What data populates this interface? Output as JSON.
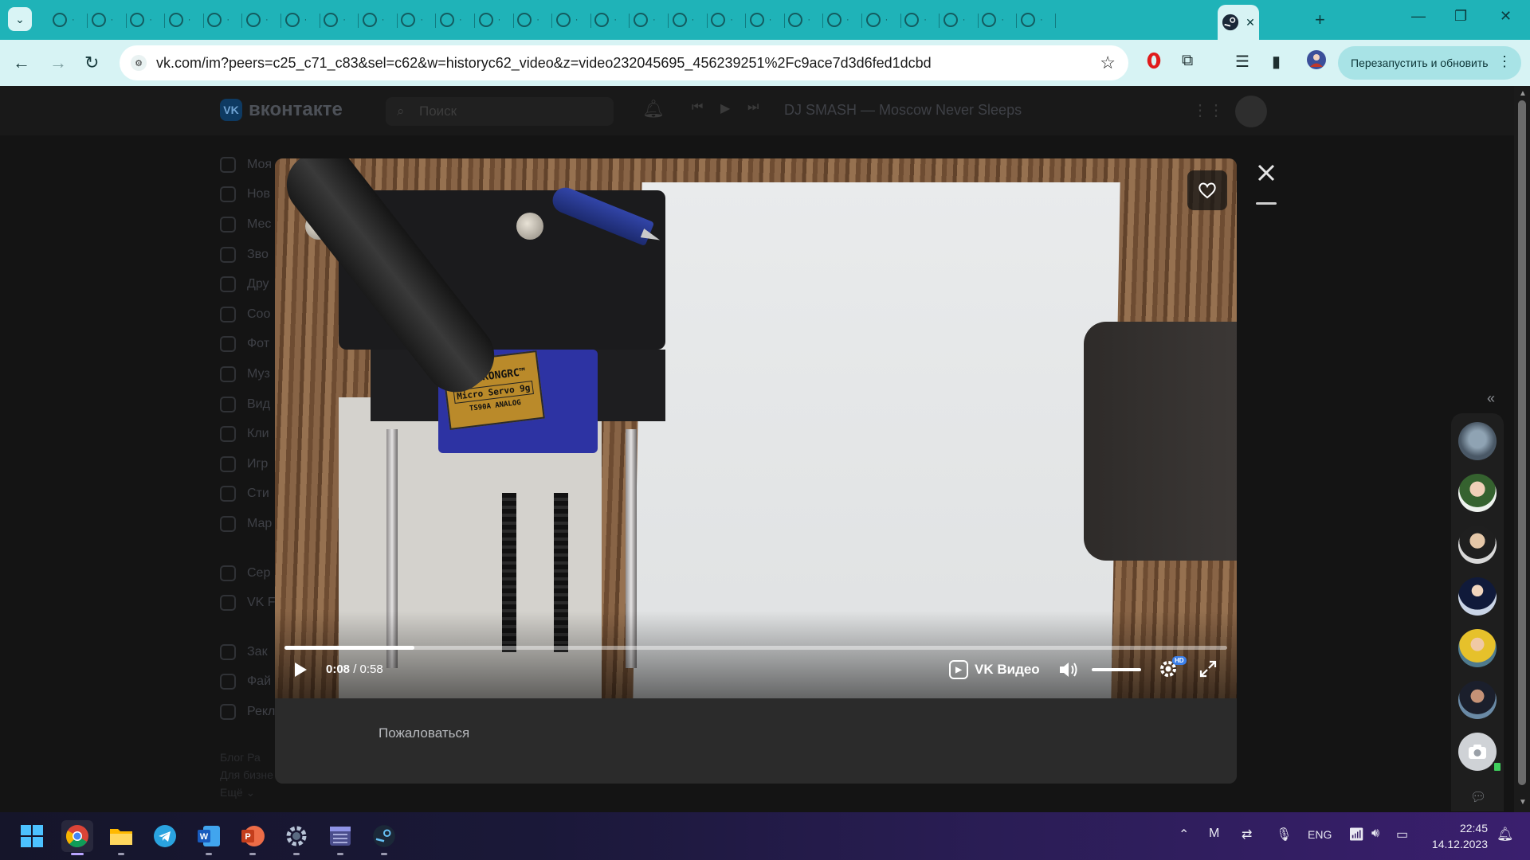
{
  "browser": {
    "url": "vk.com/im?peers=c25_c71_c83&sel=c62&w=historyc62_video&z=video232045695_456239251%2Fc9ace7d3d6fed1dcbd",
    "relaunch_label": "Перезапустить и обновить",
    "tab_count_visible": 26,
    "active_tab_icon": "steam-icon"
  },
  "vk": {
    "logo_text": "вконтакте",
    "search_placeholder": "Поиск",
    "now_playing": "DJ SMASH — Moscow Never Sleeps",
    "sidebar": [
      {
        "label": "Моя",
        "icon": "user-circle-icon"
      },
      {
        "label": "Нов",
        "icon": "newsfeed-icon"
      },
      {
        "label": "Мес",
        "icon": "messages-icon"
      },
      {
        "label": "Зво",
        "icon": "phone-icon"
      },
      {
        "label": "Дру",
        "icon": "friends-icon"
      },
      {
        "label": "Соо",
        "icon": "communities-icon"
      },
      {
        "label": "Фот",
        "icon": "photos-icon"
      },
      {
        "label": "Муз",
        "icon": "music-icon"
      },
      {
        "label": "Вид",
        "icon": "video-icon"
      },
      {
        "label": "Кли",
        "icon": "clips-icon"
      },
      {
        "label": "Игр",
        "icon": "games-icon"
      },
      {
        "label": "Сти",
        "icon": "stickers-icon"
      },
      {
        "label": "Мар",
        "icon": "market-icon"
      }
    ],
    "sidebar_group2": [
      {
        "label": "Сер",
        "icon": "services-icon"
      },
      {
        "label": "VK F",
        "icon": "vk-pay-icon"
      }
    ],
    "sidebar_group3": [
      {
        "label": "Зак",
        "icon": "bookmarks-icon"
      },
      {
        "label": "Фай",
        "icon": "files-icon"
      },
      {
        "label": "Рекл",
        "icon": "ads-icon"
      }
    ],
    "footer_line1": "Блог  Ра",
    "footer_line2": "Для бизне",
    "footer_line3": "Ещё ⌄"
  },
  "video": {
    "servo_brand": "TIANKONGRC™",
    "servo_model": "Micro Servo 9g",
    "servo_part": "TS90A ANALOG",
    "time_current": "0:08",
    "time_total": "0:58",
    "progress_fraction": 0.138,
    "volume_fraction": 1.0,
    "brand_label": "VK Видео",
    "hd_badge": "HD",
    "report_label": "Пожаловаться"
  },
  "taskbar": {
    "apps": [
      "windows-start-icon",
      "chrome-icon",
      "file-explorer-icon",
      "telegram-icon",
      "word-icon",
      "powerpoint-icon",
      "settings-icon",
      "calendar-app-icon",
      "steam-icon"
    ],
    "language": "ENG",
    "time": "22:45",
    "date": "14.12.2023"
  },
  "colors": {
    "tabstrip": "#1fb3b8",
    "toolbar": "#d7f3f4",
    "vk_bg": "#141414",
    "modal_bg": "#2b2b2b"
  }
}
